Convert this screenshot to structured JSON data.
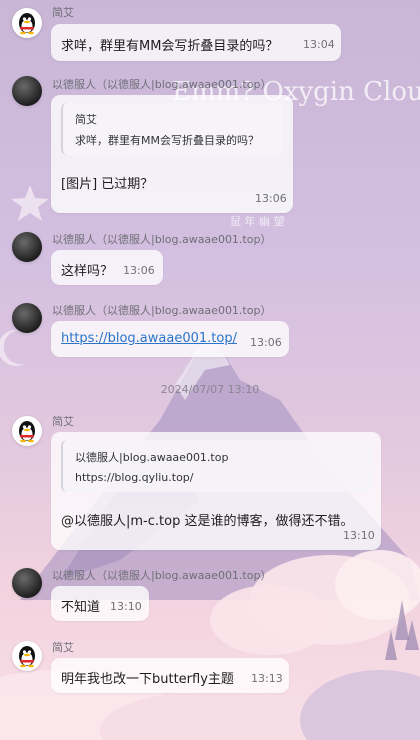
{
  "separator_time": "2024/07/07 13:10",
  "overlay_title": "Emm? Oxygin Clouds Bridge",
  "overlay_sub": "鼠 年 幽 望",
  "messages": [
    {
      "sender": "简艾",
      "text": "求咩，群里有MM会写折叠目录的吗？",
      "time": "13:04"
    },
    {
      "sender": "以德服人（以德服人|blog.awaae001.top）",
      "quote_author": "简艾",
      "quote_text": "求咩，群里有MM会写折叠目录的吗？",
      "text": "[图片] 已过期？",
      "time": "13:06"
    },
    {
      "sender": "以德服人（以德服人|blog.awaae001.top）",
      "text": "这样吗？",
      "time": "13:06"
    },
    {
      "sender": "以德服人（以德服人|blog.awaae001.top）",
      "text": "https://blog.awaae001.top/",
      "time": "13:06"
    },
    {
      "sender": "简艾",
      "quote_author": "以德服人|blog.awaae001.top",
      "quote_text": "https://blog.qyliu.top/",
      "text": "@以德服人|m-c.top 这是谁的博客，做得还不错。",
      "time": "13:10"
    },
    {
      "sender": "以德服人（以德服人|blog.awaae001.top）",
      "text": "不知道",
      "time": "13:10"
    },
    {
      "sender": "简艾",
      "text": "明年我也改一下butterfly主题",
      "time": "13:13"
    }
  ]
}
